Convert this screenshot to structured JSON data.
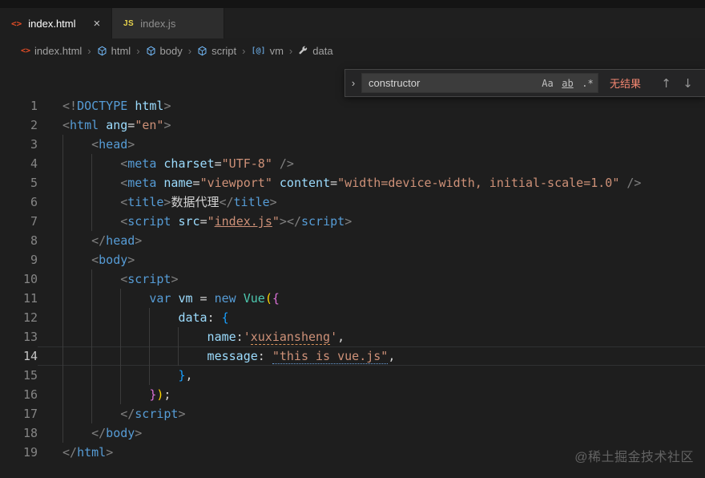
{
  "tabs": [
    {
      "label": "index.html",
      "active": true
    },
    {
      "label": "index.js",
      "active": false
    }
  ],
  "breadcrumb": [
    {
      "label": "index.html"
    },
    {
      "label": "html"
    },
    {
      "label": "body"
    },
    {
      "label": "script"
    },
    {
      "label": "vm"
    },
    {
      "label": "data"
    }
  ],
  "find": {
    "query": "constructor",
    "match_case": "Aa",
    "whole_word": "ab",
    "regex": ".*",
    "results": "无结果"
  },
  "icons": {
    "html_file": "<>",
    "js_file": "JS",
    "close": "×",
    "chevron": "›",
    "collapse": "›",
    "arrow_up": "↑",
    "arrow_down": "↓"
  },
  "colors": {
    "accent_error": "#f48771",
    "tag": "#569cd6",
    "string": "#ce9178",
    "class": "#4ec9b0"
  },
  "watermark": "@稀土掘金技术社区",
  "editor": {
    "current_line": 14,
    "lines": [
      {
        "num": 1,
        "indent": 0,
        "tokens": [
          [
            "<!",
            "p"
          ],
          [
            "DOCTYPE",
            "t"
          ],
          [
            " ",
            "w"
          ],
          [
            "html",
            "a"
          ],
          [
            ">",
            "p"
          ]
        ]
      },
      {
        "num": 2,
        "indent": 0,
        "tokens": [
          [
            "<",
            "p"
          ],
          [
            "html",
            "t"
          ],
          [
            " ",
            "w"
          ],
          [
            "ang",
            "a"
          ],
          [
            "=",
            "w"
          ],
          [
            "\"en\"",
            "s"
          ],
          [
            ">",
            "p"
          ]
        ]
      },
      {
        "num": 3,
        "indent": 1,
        "tokens": [
          [
            "<",
            "p"
          ],
          [
            "head",
            "t"
          ],
          [
            ">",
            "p"
          ]
        ]
      },
      {
        "num": 4,
        "indent": 2,
        "tokens": [
          [
            "<",
            "p"
          ],
          [
            "meta",
            "t"
          ],
          [
            " ",
            "w"
          ],
          [
            "charset",
            "a"
          ],
          [
            "=",
            "w"
          ],
          [
            "\"UTF-8\"",
            "s"
          ],
          [
            " />",
            "p"
          ]
        ]
      },
      {
        "num": 5,
        "indent": 2,
        "tokens": [
          [
            "<",
            "p"
          ],
          [
            "meta",
            "t"
          ],
          [
            " ",
            "w"
          ],
          [
            "name",
            "a"
          ],
          [
            "=",
            "w"
          ],
          [
            "\"viewport\"",
            "s"
          ],
          [
            " ",
            "w"
          ],
          [
            "content",
            "a"
          ],
          [
            "=",
            "w"
          ],
          [
            "\"width=device-width, initial-scale=1.0\"",
            "s"
          ],
          [
            " />",
            "p"
          ]
        ]
      },
      {
        "num": 6,
        "indent": 2,
        "tokens": [
          [
            "<",
            "p"
          ],
          [
            "title",
            "t"
          ],
          [
            ">",
            "p"
          ],
          [
            "数据代理",
            "x"
          ],
          [
            "</",
            "p"
          ],
          [
            "title",
            "t"
          ],
          [
            ">",
            "p"
          ]
        ]
      },
      {
        "num": 7,
        "indent": 2,
        "tokens": [
          [
            "<",
            "p"
          ],
          [
            "script",
            "t"
          ],
          [
            " ",
            "w"
          ],
          [
            "src",
            "a"
          ],
          [
            "=",
            "w"
          ],
          [
            "\"",
            "s"
          ],
          [
            "index.js",
            "s ln"
          ],
          [
            "\"",
            "s"
          ],
          [
            ">",
            "p"
          ],
          [
            "</",
            "p"
          ],
          [
            "script",
            "t"
          ],
          [
            ">",
            "p"
          ]
        ]
      },
      {
        "num": 8,
        "indent": 1,
        "tokens": [
          [
            "</",
            "p"
          ],
          [
            "head",
            "t"
          ],
          [
            ">",
            "p"
          ]
        ]
      },
      {
        "num": 9,
        "indent": 1,
        "tokens": [
          [
            "<",
            "p"
          ],
          [
            "body",
            "t"
          ],
          [
            ">",
            "p"
          ]
        ]
      },
      {
        "num": 10,
        "indent": 2,
        "tokens": [
          [
            "<",
            "p"
          ],
          [
            "script",
            "t"
          ],
          [
            ">",
            "p"
          ]
        ]
      },
      {
        "num": 11,
        "indent": 3,
        "tokens": [
          [
            "var",
            "k"
          ],
          [
            " ",
            "w"
          ],
          [
            "vm",
            "v"
          ],
          [
            " = ",
            "w"
          ],
          [
            "new",
            "k"
          ],
          [
            " ",
            "w"
          ],
          [
            "Vue",
            "c"
          ],
          [
            "(",
            "b1"
          ],
          [
            "{",
            "b2"
          ]
        ]
      },
      {
        "num": 12,
        "indent": 4,
        "tokens": [
          [
            "data",
            "v"
          ],
          [
            ": ",
            "w"
          ],
          [
            "{",
            "b3"
          ]
        ]
      },
      {
        "num": 13,
        "indent": 5,
        "tokens": [
          [
            "name",
            "v"
          ],
          [
            ":",
            "w"
          ],
          [
            "'",
            "s"
          ],
          [
            "xuxiansheng",
            "s du"
          ],
          [
            "'",
            "s"
          ],
          [
            ",",
            "w"
          ]
        ]
      },
      {
        "num": 14,
        "indent": 5,
        "tokens": [
          [
            "message",
            "v"
          ],
          [
            ": ",
            "w"
          ],
          [
            "\"this is vue.js\"",
            "s dd"
          ],
          [
            ",",
            "w"
          ]
        ]
      },
      {
        "num": 15,
        "indent": 4,
        "tokens": [
          [
            "}",
            "b3"
          ],
          [
            ",",
            "w"
          ]
        ]
      },
      {
        "num": 16,
        "indent": 3,
        "tokens": [
          [
            "}",
            "b2"
          ],
          [
            ")",
            "b1"
          ],
          [
            ";",
            "w"
          ]
        ]
      },
      {
        "num": 17,
        "indent": 2,
        "tokens": [
          [
            "</",
            "p"
          ],
          [
            "script",
            "t"
          ],
          [
            ">",
            "p"
          ]
        ]
      },
      {
        "num": 18,
        "indent": 1,
        "tokens": [
          [
            "</",
            "p"
          ],
          [
            "body",
            "t"
          ],
          [
            ">",
            "p"
          ]
        ]
      },
      {
        "num": 19,
        "indent": 0,
        "tokens": [
          [
            "</",
            "p"
          ],
          [
            "html",
            "t"
          ],
          [
            ">",
            "p"
          ]
        ]
      }
    ]
  }
}
